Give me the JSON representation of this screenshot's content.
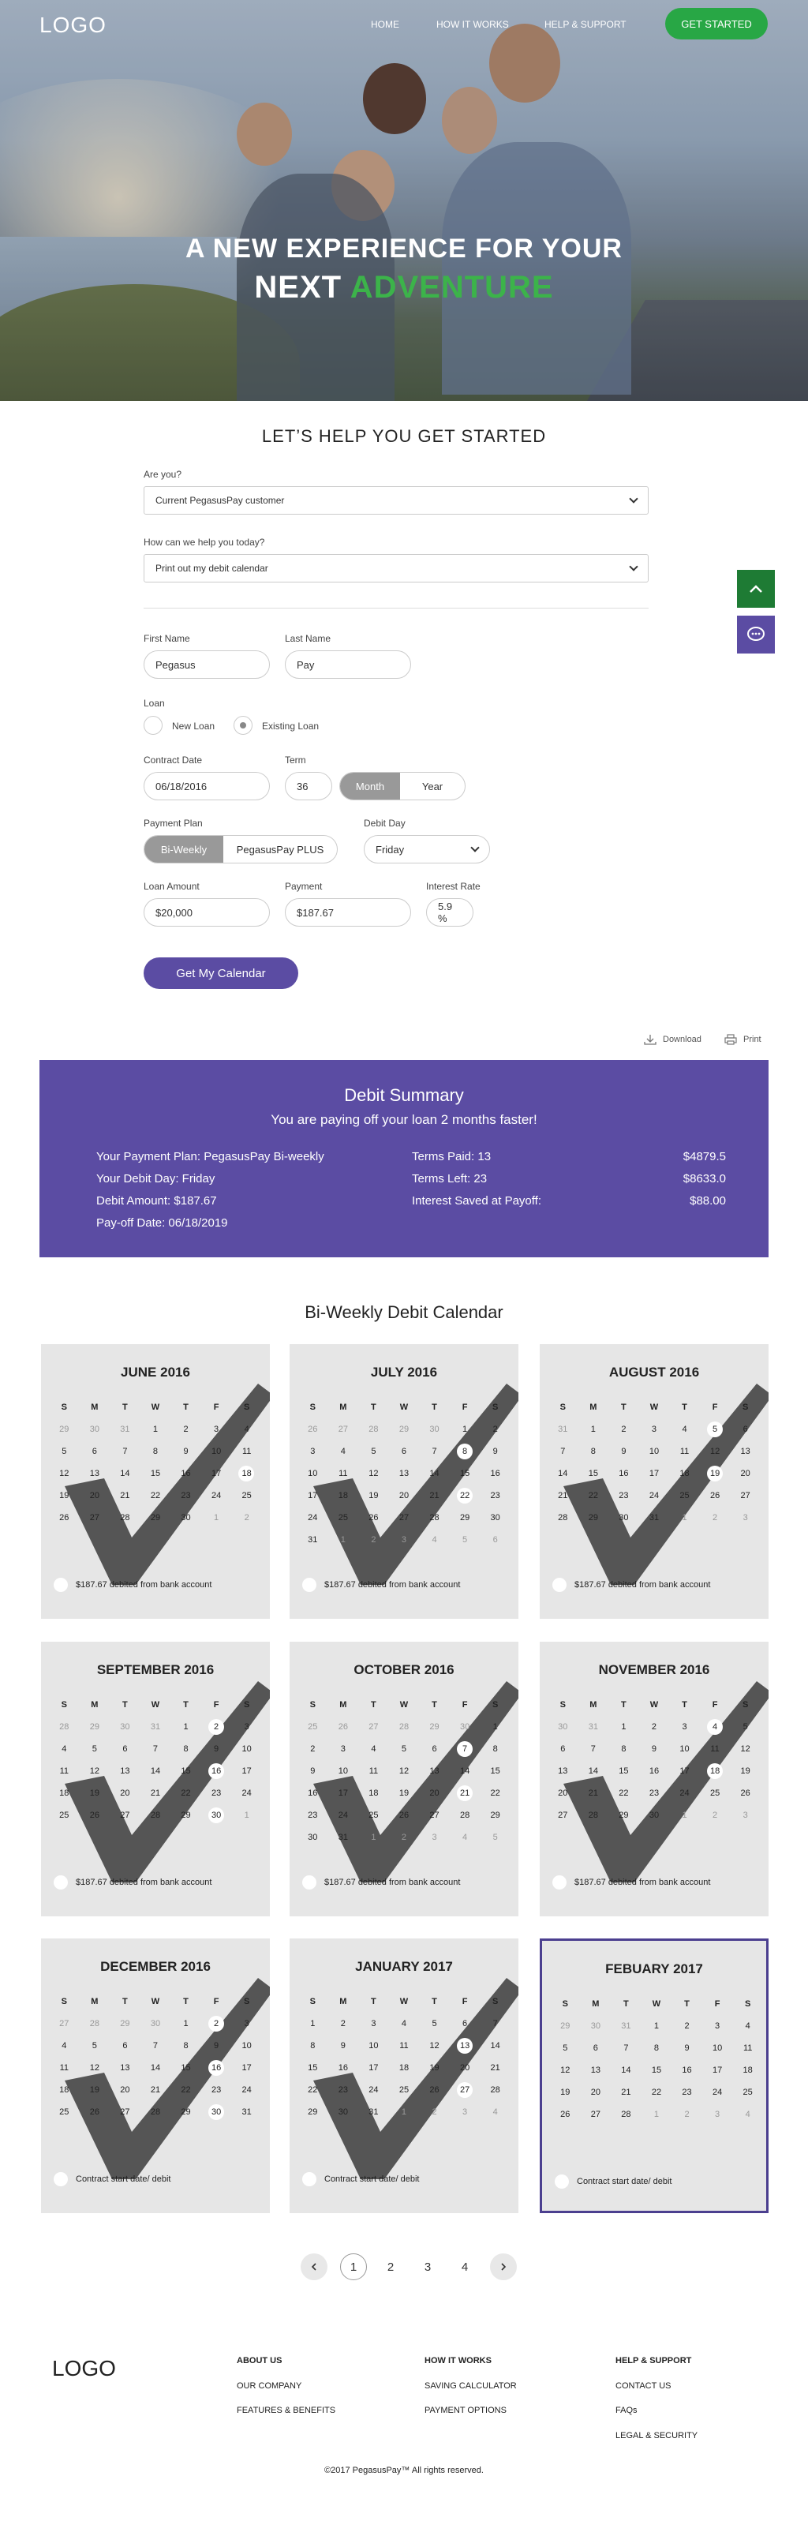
{
  "header": {
    "logo": "LOGO",
    "nav": [
      "HOME",
      "HOW IT WORKS",
      "HELP & SUPPORT"
    ],
    "cta": "GET STARTED"
  },
  "hero": {
    "line1": "A NEW EXPERIENCE FOR YOUR",
    "line2_white": "NEXT",
    "line2_green": "ADVENTURE"
  },
  "form": {
    "title": "LET’S HELP YOU GET STARTED",
    "are_you_label": "Are you?",
    "are_you_value": "Current PegasusPay customer",
    "how_help_label": "How can we help you today?",
    "how_help_value": "Print out my debit calendar",
    "first_name_label": "First Name",
    "first_name_value": "Pegasus",
    "last_name_label": "Last Name",
    "last_name_value": "Pay",
    "loan_label": "Loan",
    "new_loan": "New Loan",
    "existing_loan": "Existing Loan",
    "contract_date_label": "Contract Date",
    "contract_date_value": "06/18/2016",
    "term_label": "Term",
    "term_value": "36",
    "term_month": "Month",
    "term_year": "Year",
    "payment_plan_label": "Payment Plan",
    "plan_biweekly": "Bi-Weekly",
    "plan_plus": "PegasusPay PLUS",
    "debit_day_label": "Debit Day",
    "debit_day_value": "Friday",
    "loan_amount_label": "Loan Amount",
    "loan_amount_value": "$20,000",
    "payment_label": "Payment",
    "payment_value": "$187.67",
    "interest_label": "Interest Rate",
    "interest_value": "5.9 %",
    "submit": "Get My Calendar"
  },
  "tools": {
    "download": "Download",
    "print": "Print"
  },
  "summary": {
    "title": "Debit Summary",
    "subtitle": "You are paying off your loan 2 months faster!",
    "plan": "Your Payment Plan: PegasusPay Bi-weekly",
    "debit_day": "Your Debit Day: Friday",
    "debit_amount": "Debit Amount: $187.67",
    "payoff": "Pay-off Date: 06/18/2019",
    "terms_paid": "Terms Paid: 13",
    "terms_left": "Terms Left: 23",
    "interest_saved": "Interest Saved at Payoff:",
    "v_paid": "$4879.5",
    "v_left": "$8633.0",
    "v_saved": "$88.00"
  },
  "calendar": {
    "title": "Bi-Weekly Debit Calendar",
    "weekdays": [
      "S",
      "M",
      "T",
      "W",
      "T",
      "F",
      "S"
    ],
    "months": [
      {
        "name": "JUNE 2016",
        "foot": "$187.67 debited from bank account",
        "check": true,
        "rows": [
          [
            "29",
            "30",
            "31",
            "1",
            "2",
            "3",
            "4"
          ],
          [
            "5",
            "6",
            "7",
            "8",
            "9",
            "10",
            "11"
          ],
          [
            "12",
            "13",
            "14",
            "15",
            "16",
            "17",
            "18"
          ],
          [
            "19",
            "20",
            "21",
            "22",
            "23",
            "24",
            "25"
          ],
          [
            "26",
            "27",
            "28",
            "29",
            "30",
            "1",
            "2"
          ]
        ],
        "dim": [
          [
            0,
            0
          ],
          [
            0,
            1
          ],
          [
            0,
            2
          ],
          [
            4,
            5
          ],
          [
            4,
            6
          ]
        ],
        "circ": [
          [
            2,
            6
          ]
        ]
      },
      {
        "name": "JULY 2016",
        "foot": "$187.67 debited from bank account",
        "check": true,
        "rows": [
          [
            "26",
            "27",
            "28",
            "29",
            "30",
            "1",
            "2"
          ],
          [
            "3",
            "4",
            "5",
            "6",
            "7",
            "8",
            "9"
          ],
          [
            "10",
            "11",
            "12",
            "13",
            "14",
            "15",
            "16"
          ],
          [
            "17",
            "18",
            "19",
            "20",
            "21",
            "22",
            "23"
          ],
          [
            "24",
            "25",
            "26",
            "27",
            "28",
            "29",
            "30"
          ],
          [
            "31",
            "1",
            "2",
            "3",
            "4",
            "5",
            "6"
          ]
        ],
        "dim": [
          [
            0,
            0
          ],
          [
            0,
            1
          ],
          [
            0,
            2
          ],
          [
            0,
            3
          ],
          [
            0,
            4
          ],
          [
            5,
            1
          ],
          [
            5,
            2
          ],
          [
            5,
            3
          ],
          [
            5,
            4
          ],
          [
            5,
            5
          ],
          [
            5,
            6
          ]
        ],
        "circ": [
          [
            1,
            5
          ],
          [
            3,
            5
          ]
        ]
      },
      {
        "name": "AUGUST 2016",
        "foot": "$187.67 debited from bank account",
        "check": true,
        "rows": [
          [
            "31",
            "1",
            "2",
            "3",
            "4",
            "5",
            "6"
          ],
          [
            "7",
            "8",
            "9",
            "10",
            "11",
            "12",
            "13"
          ],
          [
            "14",
            "15",
            "16",
            "17",
            "18",
            "19",
            "20"
          ],
          [
            "21",
            "22",
            "23",
            "24",
            "25",
            "26",
            "27"
          ],
          [
            "28",
            "29",
            "30",
            "31",
            "1",
            "2",
            "3"
          ]
        ],
        "dim": [
          [
            0,
            0
          ],
          [
            4,
            4
          ],
          [
            4,
            5
          ],
          [
            4,
            6
          ]
        ],
        "circ": [
          [
            0,
            5
          ],
          [
            2,
            5
          ]
        ]
      },
      {
        "name": "SEPTEMBER 2016",
        "foot": "$187.67 debited from bank account",
        "check": true,
        "rows": [
          [
            "28",
            "29",
            "30",
            "31",
            "1",
            "2",
            "3"
          ],
          [
            "4",
            "5",
            "6",
            "7",
            "8",
            "9",
            "10"
          ],
          [
            "11",
            "12",
            "13",
            "14",
            "15",
            "16",
            "17"
          ],
          [
            "18",
            "19",
            "20",
            "21",
            "22",
            "23",
            "24"
          ],
          [
            "25",
            "26",
            "27",
            "28",
            "29",
            "30",
            "1"
          ]
        ],
        "dim": [
          [
            0,
            0
          ],
          [
            0,
            1
          ],
          [
            0,
            2
          ],
          [
            0,
            3
          ],
          [
            4,
            6
          ]
        ],
        "circ": [
          [
            0,
            5
          ],
          [
            2,
            5
          ],
          [
            4,
            5
          ]
        ]
      },
      {
        "name": "OCTOBER 2016",
        "foot": "$187.67 debited from bank account",
        "check": true,
        "rows": [
          [
            "25",
            "26",
            "27",
            "28",
            "29",
            "30",
            "1"
          ],
          [
            "2",
            "3",
            "4",
            "5",
            "6",
            "7",
            "8"
          ],
          [
            "9",
            "10",
            "11",
            "12",
            "13",
            "14",
            "15"
          ],
          [
            "16",
            "17",
            "18",
            "19",
            "20",
            "21",
            "22"
          ],
          [
            "23",
            "24",
            "25",
            "26",
            "27",
            "28",
            "29"
          ],
          [
            "30",
            "31",
            "1",
            "2",
            "3",
            "4",
            "5"
          ]
        ],
        "dim": [
          [
            0,
            0
          ],
          [
            0,
            1
          ],
          [
            0,
            2
          ],
          [
            0,
            3
          ],
          [
            0,
            4
          ],
          [
            0,
            5
          ],
          [
            5,
            2
          ],
          [
            5,
            3
          ],
          [
            5,
            4
          ],
          [
            5,
            5
          ],
          [
            5,
            6
          ]
        ],
        "circ": [
          [
            1,
            5
          ],
          [
            3,
            5
          ]
        ]
      },
      {
        "name": "NOVEMBER 2016",
        "foot": "$187.67 debited from bank account",
        "check": true,
        "rows": [
          [
            "30",
            "31",
            "1",
            "2",
            "3",
            "4",
            "5"
          ],
          [
            "6",
            "7",
            "8",
            "9",
            "10",
            "11",
            "12"
          ],
          [
            "13",
            "14",
            "15",
            "16",
            "17",
            "18",
            "19"
          ],
          [
            "20",
            "21",
            "22",
            "23",
            "24",
            "25",
            "26"
          ],
          [
            "27",
            "28",
            "29",
            "30",
            "1",
            "2",
            "3"
          ]
        ],
        "dim": [
          [
            0,
            0
          ],
          [
            0,
            1
          ],
          [
            4,
            4
          ],
          [
            4,
            5
          ],
          [
            4,
            6
          ]
        ],
        "circ": [
          [
            0,
            5
          ],
          [
            2,
            5
          ]
        ]
      },
      {
        "name": "DECEMBER 2016",
        "foot": "Contract start date/ debit",
        "check": true,
        "rows": [
          [
            "27",
            "28",
            "29",
            "30",
            "1",
            "2",
            "3"
          ],
          [
            "4",
            "5",
            "6",
            "7",
            "8",
            "9",
            "10"
          ],
          [
            "11",
            "12",
            "13",
            "14",
            "15",
            "16",
            "17"
          ],
          [
            "18",
            "19",
            "20",
            "21",
            "22",
            "23",
            "24"
          ],
          [
            "25",
            "26",
            "27",
            "28",
            "29",
            "30",
            "31"
          ]
        ],
        "dim": [
          [
            0,
            0
          ],
          [
            0,
            1
          ],
          [
            0,
            2
          ],
          [
            0,
            3
          ]
        ],
        "circ": [
          [
            0,
            5
          ],
          [
            2,
            5
          ],
          [
            4,
            5
          ]
        ]
      },
      {
        "name": "JANUARY 2017",
        "foot": "Contract start date/ debit",
        "check": true,
        "rows": [
          [
            "1",
            "2",
            "3",
            "4",
            "5",
            "6",
            "7"
          ],
          [
            "8",
            "9",
            "10",
            "11",
            "12",
            "13",
            "14"
          ],
          [
            "15",
            "16",
            "17",
            "18",
            "19",
            "20",
            "21"
          ],
          [
            "22",
            "23",
            "24",
            "25",
            "26",
            "27",
            "28"
          ],
          [
            "29",
            "30",
            "31",
            "1",
            "2",
            "3",
            "4"
          ]
        ],
        "dim": [
          [
            4,
            3
          ],
          [
            4,
            4
          ],
          [
            4,
            5
          ],
          [
            4,
            6
          ]
        ],
        "circ": [
          [
            1,
            5
          ],
          [
            3,
            5
          ]
        ]
      },
      {
        "name": "FEBUARY 2017",
        "foot": "Contract start date/ debit",
        "check": false,
        "rows": [
          [
            "29",
            "30",
            "31",
            "1",
            "2",
            "3",
            "4"
          ],
          [
            "5",
            "6",
            "7",
            "8",
            "9",
            "10",
            "11"
          ],
          [
            "12",
            "13",
            "14",
            "15",
            "16",
            "17",
            "18"
          ],
          [
            "19",
            "20",
            "21",
            "22",
            "23",
            "24",
            "25"
          ],
          [
            "26",
            "27",
            "28",
            "1",
            "2",
            "3",
            "4"
          ]
        ],
        "dim": [
          [
            0,
            0
          ],
          [
            0,
            1
          ],
          [
            0,
            2
          ],
          [
            4,
            3
          ],
          [
            4,
            4
          ],
          [
            4,
            5
          ],
          [
            4,
            6
          ]
        ],
        "circ": []
      }
    ]
  },
  "pagination": [
    "1",
    "2",
    "3",
    "4"
  ],
  "footer": {
    "logo": "LOGO",
    "col1": {
      "head": "ABOUT US",
      "links": [
        "OUR COMPANY",
        "FEATURES & BENEFITS"
      ]
    },
    "col2": {
      "head": "HOW IT WORKS",
      "links": [
        "SAVING CALCULATOR",
        "PAYMENT OPTIONS"
      ]
    },
    "col3": {
      "head": "HELP & SUPPORT",
      "links": [
        "CONTACT US",
        "FAQs",
        "LEGAL & SECURITY"
      ]
    },
    "copyright": "©2017 PegasusPay™ All rights reserved."
  },
  "colors": {
    "brand_purple": "#5b4ca3",
    "accent_green": "#28a745",
    "side_green": "#1e7b34",
    "calendar_bg": "#e6e6e6"
  },
  "icons": [
    "chevron-down-icon",
    "chevron-up-icon",
    "chat-icon",
    "download-icon",
    "print-icon",
    "checkmark-icon",
    "arrow-left-icon",
    "arrow-right-icon"
  ]
}
